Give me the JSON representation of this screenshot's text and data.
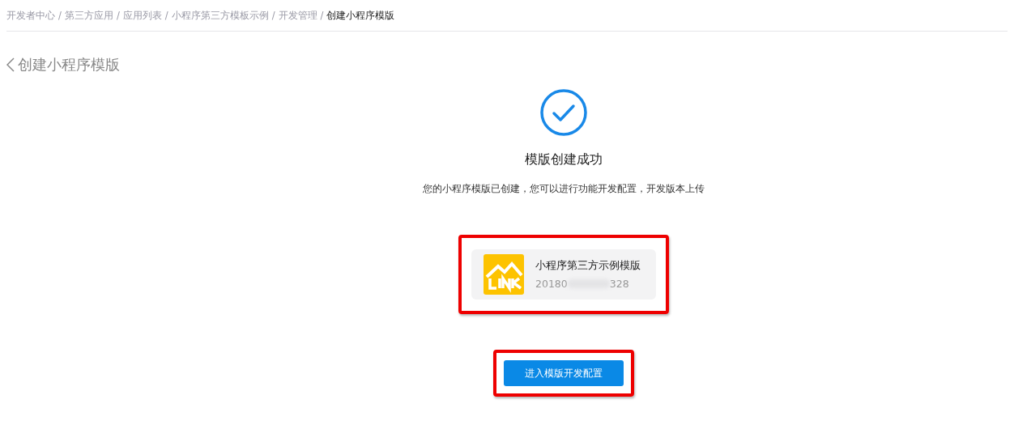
{
  "breadcrumb": [
    {
      "label": "开发者中心",
      "current": false
    },
    {
      "label": "第三方应用",
      "current": false
    },
    {
      "label": "应用列表",
      "current": false
    },
    {
      "label": "小程序第三方模板示例",
      "current": false
    },
    {
      "label": "开发管理",
      "current": false
    },
    {
      "label": "创建小程序模版",
      "current": true
    }
  ],
  "separator": "/",
  "page_title": "创建小程序模版",
  "result": {
    "title": "模版创建成功",
    "description": "您的小程序模版已创建，您可以进行功能开发配置，开发版本上传"
  },
  "template_card": {
    "name": "小程序第三方示例模版",
    "id_start": "20180",
    "id_end": "328",
    "highlighted": true
  },
  "primary_button": {
    "label": "进入模版开发配置",
    "highlighted": true
  }
}
